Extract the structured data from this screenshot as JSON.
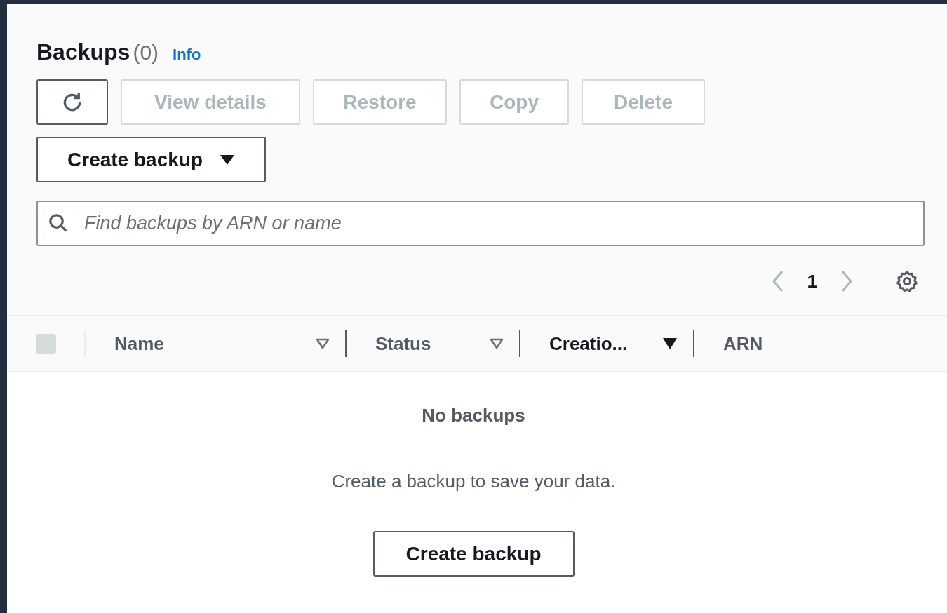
{
  "header": {
    "title": "Backups",
    "count": "(0)",
    "info_link": "Info"
  },
  "toolbar": [
    {
      "kind": "refresh",
      "disabled": false
    },
    {
      "kind": "text",
      "label": "View details",
      "disabled": true
    },
    {
      "kind": "text",
      "label": "Restore",
      "disabled": true
    },
    {
      "kind": "text",
      "label": "Copy",
      "disabled": true
    },
    {
      "kind": "text",
      "label": "Delete",
      "disabled": true
    }
  ],
  "create_menu": {
    "label": "Create backup"
  },
  "search": {
    "placeholder": "Find backups by ARN or name"
  },
  "pagination": {
    "page": "1"
  },
  "table": {
    "select_all": {
      "checked": false,
      "disabled": true
    },
    "columns": [
      {
        "label": "Name",
        "sortable": true,
        "sorted": false
      },
      {
        "label": "Status",
        "sortable": true,
        "sorted": false
      },
      {
        "label": "Creatio...",
        "sortable": true,
        "sorted": true
      },
      {
        "label": "ARN",
        "sortable": false,
        "sorted": false
      }
    ]
  },
  "empty_state": {
    "title": "No backups",
    "message": "Create a backup to save your data.",
    "button": "Create backup"
  }
}
